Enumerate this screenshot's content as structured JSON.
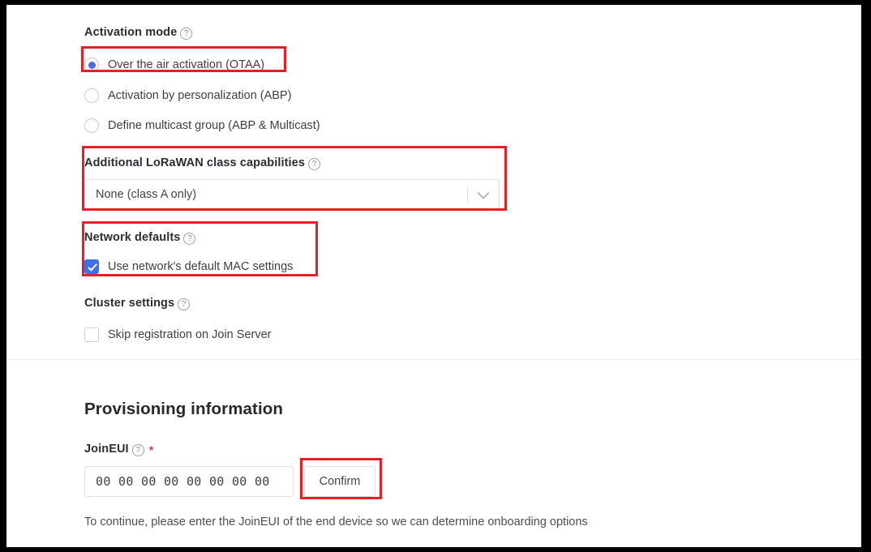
{
  "activation": {
    "label": "Activation mode",
    "help_icon": "help-circle-icon",
    "options": [
      {
        "label": "Over the air activation (OTAA)",
        "selected": true
      },
      {
        "label": "Activation by personalization (ABP)",
        "selected": false
      },
      {
        "label": "Define multicast group (ABP & Multicast)",
        "selected": false
      }
    ]
  },
  "class_capabilities": {
    "label": "Additional LoRaWAN class capabilities",
    "help_icon": "help-circle-icon",
    "selected_value": "None (class A only)",
    "dropdown_icon": "chevron-down-icon"
  },
  "network_defaults": {
    "label": "Network defaults",
    "help_icon": "help-circle-icon",
    "checkbox_label": "Use network's default MAC settings",
    "checked": true
  },
  "cluster_settings": {
    "label": "Cluster settings",
    "help_icon": "help-circle-icon",
    "checkbox_label": "Skip registration on Join Server",
    "checked": false
  },
  "provisioning": {
    "title": "Provisioning information",
    "joineui": {
      "label": "JoinEUI",
      "help_icon": "help-circle-icon",
      "required_marker": "*",
      "value": "00 00 00 00 00 00 00 00",
      "placeholder": "00 00 00 00 00 00 00 00"
    },
    "confirm_label": "Confirm",
    "hint": "To continue, please enter the JoinEUI of the end device so we can determine onboarding options"
  },
  "colors": {
    "annotation": "#ec1c24",
    "radio_selected": "#4a6cf0",
    "checkbox_checked": "#3b72e8",
    "required": "#e53935"
  }
}
